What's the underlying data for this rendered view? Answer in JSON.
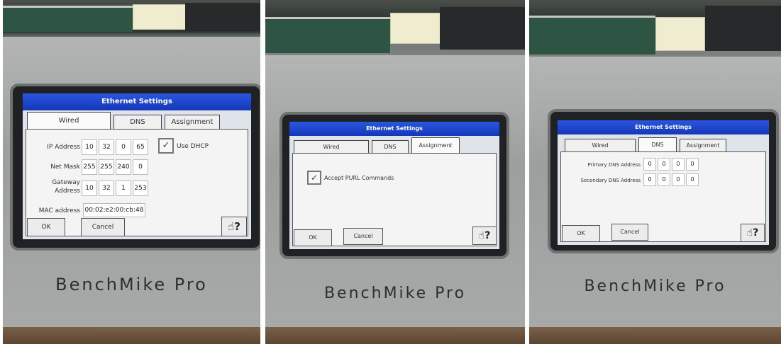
{
  "panels": [
    {
      "title": "Ethernet Settings",
      "brand": "BenchMike Pro",
      "tabs": [
        "Wired",
        "DNS",
        "Assignment"
      ],
      "active_tab": "Wired",
      "fields": {
        "ip_label": "IP Address",
        "ip": [
          "10",
          "32",
          "0",
          "65"
        ],
        "mask_label": "Net Mask",
        "mask": [
          "255",
          "255",
          "240",
          "0"
        ],
        "gateway_label_1": "Gateway",
        "gateway_label_2": "Address",
        "gateway": [
          "10",
          "32",
          "1",
          "253"
        ],
        "mac_label": "MAC address",
        "mac": "00:02:e2:00:cb:48",
        "dhcp_label": "Use DHCP",
        "dhcp_checked": true
      },
      "ok_label": "OK",
      "cancel_label": "Cancel",
      "help_glyph": "?"
    },
    {
      "title": "Ethernet Settings",
      "brand": "BenchMike Pro",
      "tabs": [
        "Wired",
        "DNS",
        "Assignment"
      ],
      "active_tab": "Assignment",
      "fields": {
        "purl_label": "Accept PURL Commands",
        "purl_checked": true
      },
      "ok_label": "OK",
      "cancel_label": "Cancel",
      "help_glyph": "?"
    },
    {
      "title": "Ethernet Settings",
      "brand": "BenchMike Pro",
      "tabs": [
        "Wired",
        "DNS",
        "Assignment"
      ],
      "active_tab": "DNS",
      "fields": {
        "primary_label": "Primary DNS Address",
        "primary": [
          "0",
          "0",
          "0",
          "0"
        ],
        "secondary_label": "Secondary DNS Address",
        "secondary": [
          "0",
          "0",
          "0",
          "0"
        ]
      },
      "ok_label": "OK",
      "cancel_label": "Cancel",
      "help_glyph": "?"
    }
  ],
  "icons": {
    "help": "hand-pointer-help-icon",
    "check": "checkmark-icon"
  },
  "colors": {
    "titlebar": "#1f45cc",
    "screen_bg": "#f4f4f4",
    "housing": "#a2a5a4"
  }
}
